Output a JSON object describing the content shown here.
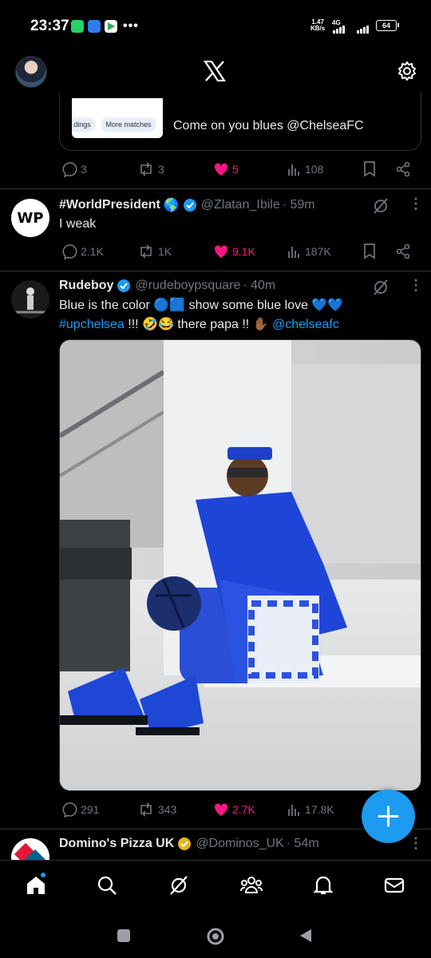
{
  "status_bar": {
    "time": "23:37",
    "net_speed_value": "1.47",
    "net_speed_unit": "KB/s",
    "network_label": "4G",
    "battery": "64",
    "overflow": "•••"
  },
  "header": {
    "logo": "X",
    "settings_icon": "gear-icon"
  },
  "quote": {
    "pill_left": "dings",
    "pill_right": "More matches",
    "text": "Come on you blues @ChelseaFC"
  },
  "tweet0_actions": {
    "replies": "3",
    "reposts": "3",
    "likes": "5",
    "views": "108"
  },
  "tweets": [
    {
      "name": "#WorldPresident",
      "emoji": "🌎",
      "handle": "@Zlatan_Ibile",
      "time": "· 59m",
      "text": "I weak",
      "replies": "2.1K",
      "reposts": "1K",
      "likes": "9.1K",
      "views": "187K"
    },
    {
      "name": "Rudeboy",
      "handle": "@rudeboypsquare",
      "time": "· 40m",
      "line1": "Blue is the color 🔵🟦 show some blue love 💙💙",
      "hashtag": "#upchelsea",
      "line2_rest": " !!! 🤣😂 there papa !! ✋🏾 ",
      "mention": "@chelseafc",
      "replies": "291",
      "reposts": "343",
      "likes": "2.7K",
      "views": "17.8K"
    },
    {
      "name": "Domino's Pizza UK",
      "handle": "@Dominos_UK",
      "time": "· 54m"
    }
  ],
  "bottom_nav": [
    "home-icon",
    "search-icon",
    "grok-icon",
    "communities-icon",
    "notifications-icon",
    "messages-icon"
  ],
  "colors": {
    "accent": "#1d9bf0",
    "like": "#f91880",
    "muted": "#71767b",
    "divider": "#2f3336",
    "gold_badge": "#e2b719"
  }
}
